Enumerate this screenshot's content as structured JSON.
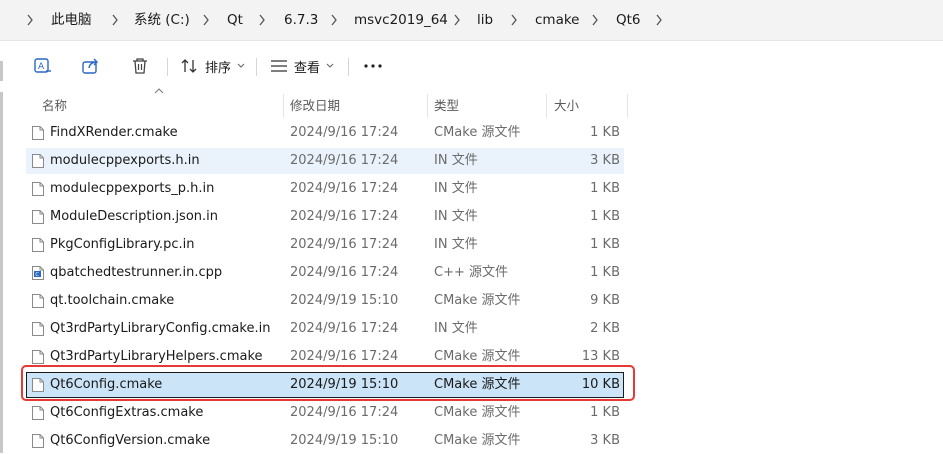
{
  "breadcrumb": [
    "此电脑",
    "系统 (C:)",
    "Qt",
    "6.7.3",
    "msvc2019_64",
    "lib",
    "cmake",
    "Qt6"
  ],
  "toolbar": {
    "rename_icon": "rename-icon",
    "share_icon": "share-icon",
    "delete_icon": "trash-icon",
    "sort_label": "排序",
    "view_label": "查看",
    "more_label": "..."
  },
  "columns": {
    "name": "名称",
    "date": "修改日期",
    "type": "类型",
    "size": "大小"
  },
  "files": [
    {
      "name": "FindXRender.cmake",
      "date": "2024/9/16 17:24",
      "type": "CMake 源文件",
      "size": "1 KB",
      "icon": "file-icon"
    },
    {
      "name": "modulecppexports.h.in",
      "date": "2024/9/16 17:24",
      "type": "IN 文件",
      "size": "3 KB",
      "icon": "file-icon"
    },
    {
      "name": "modulecppexports_p.h.in",
      "date": "2024/9/16 17:24",
      "type": "IN 文件",
      "size": "1 KB",
      "icon": "file-icon"
    },
    {
      "name": "ModuleDescription.json.in",
      "date": "2024/9/16 17:24",
      "type": "IN 文件",
      "size": "1 KB",
      "icon": "file-icon"
    },
    {
      "name": "PkgConfigLibrary.pc.in",
      "date": "2024/9/16 17:24",
      "type": "IN 文件",
      "size": "1 KB",
      "icon": "file-icon"
    },
    {
      "name": "qbatchedtestrunner.in.cpp",
      "date": "2024/9/16 17:24",
      "type": "C++ 源文件",
      "size": "1 KB",
      "icon": "cpp-file-icon"
    },
    {
      "name": "qt.toolchain.cmake",
      "date": "2024/9/19 15:10",
      "type": "CMake 源文件",
      "size": "9 KB",
      "icon": "file-icon"
    },
    {
      "name": "Qt3rdPartyLibraryConfig.cmake.in",
      "date": "2024/9/16 17:24",
      "type": "IN 文件",
      "size": "2 KB",
      "icon": "file-icon"
    },
    {
      "name": "Qt3rdPartyLibraryHelpers.cmake",
      "date": "2024/9/16 17:24",
      "type": "CMake 源文件",
      "size": "13 KB",
      "icon": "file-icon"
    },
    {
      "name": "Qt6Config.cmake",
      "date": "2024/9/19 15:10",
      "type": "CMake 源文件",
      "size": "10 KB",
      "icon": "file-icon"
    },
    {
      "name": "Qt6ConfigExtras.cmake",
      "date": "2024/9/16 17:24",
      "type": "CMake 源文件",
      "size": "1 KB",
      "icon": "file-icon"
    },
    {
      "name": "Qt6ConfigVersion.cmake",
      "date": "2024/9/19 15:10",
      "type": "CMake 源文件",
      "size": "3 KB",
      "icon": "file-icon"
    }
  ],
  "colors": {
    "selection": "#cce4f7",
    "hover": "#eaf3fc",
    "highlight_border": "#e53935"
  }
}
